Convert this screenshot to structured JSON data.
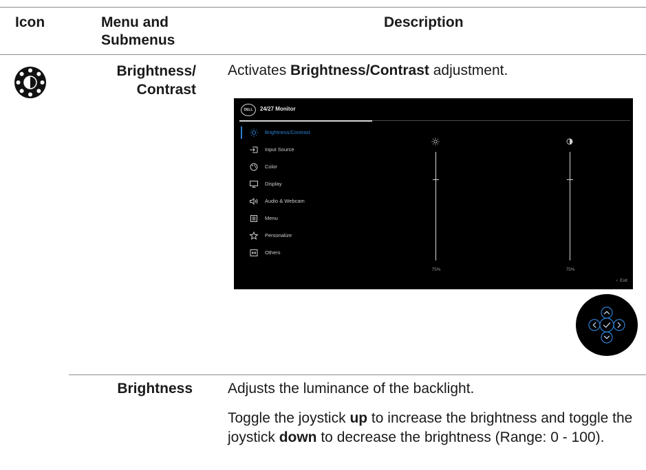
{
  "table": {
    "headers": {
      "icon": "Icon",
      "menu": "Menu and Submenus",
      "description": "Description"
    },
    "row1": {
      "icon": "brightness-icon",
      "menu_label": "Brightness/ Contrast",
      "desc_prefix": "Activates ",
      "desc_bold": "Brightness/Contrast",
      "desc_suffix": " adjustment."
    },
    "row2": {
      "menu_label": "Brightness",
      "desc_line1": "Adjusts the luminance of the backlight.",
      "desc_p2_a": "Toggle the joystick ",
      "desc_p2_b": "up",
      "desc_p2_c": " to increase the brightness and toggle the joystick ",
      "desc_p2_d": "down",
      "desc_p2_e": " to decrease the brightness (Range: 0 - 100)."
    }
  },
  "osd": {
    "logo": "DELL",
    "title": "24/27 Monitor",
    "menu_items": [
      {
        "label": "Brightness/Contrast",
        "icon": "sun-icon",
        "active": true
      },
      {
        "label": "Input Source",
        "icon": "input-source-icon",
        "active": false
      },
      {
        "label": "Color",
        "icon": "color-palette-icon",
        "active": false
      },
      {
        "label": "Display",
        "icon": "display-icon",
        "active": false
      },
      {
        "label": "Audio & Webcam",
        "icon": "speaker-icon",
        "active": false
      },
      {
        "label": "Menu",
        "icon": "menu-icon",
        "active": false
      },
      {
        "label": "Personalize",
        "icon": "star-icon",
        "active": false
      },
      {
        "label": "Others",
        "icon": "others-icon",
        "active": false
      }
    ],
    "brightness": {
      "value": "75%",
      "level": 75,
      "icon": "sun-icon"
    },
    "contrast": {
      "value": "75%",
      "level": 75,
      "icon": "contrast-icon"
    },
    "exit_label": "Exit",
    "accent": "#2a7fd4"
  },
  "joystick": {
    "icons": [
      "up-icon",
      "left-icon",
      "check-icon",
      "right-icon",
      "down-icon"
    ]
  }
}
